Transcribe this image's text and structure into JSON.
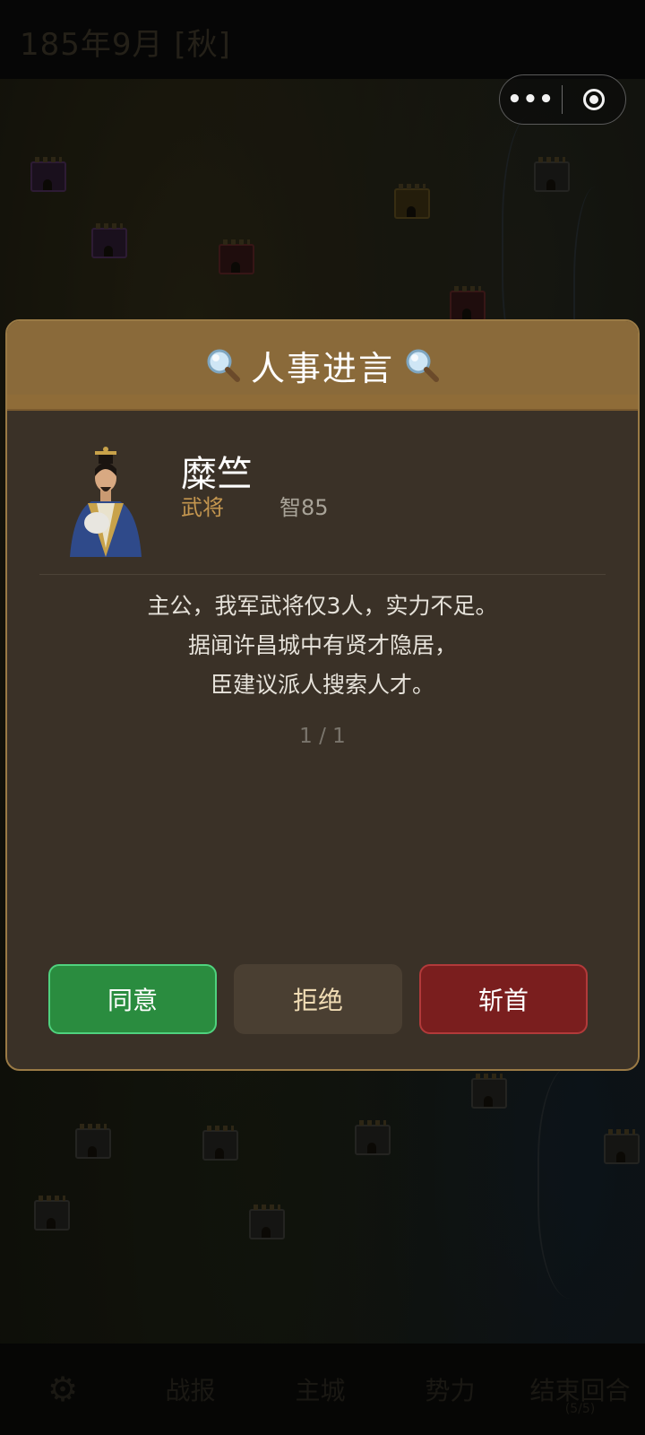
{
  "status_bar": {
    "date": "185年9月 [秋]"
  },
  "capsule": {
    "more_icon": "more-dots-icon",
    "more_glyph": "•••",
    "close_icon": "target-circle-icon"
  },
  "dialog": {
    "title": "人事进言",
    "title_icon": "magnifier-icon",
    "advisor": {
      "name": "糜竺",
      "role": "武将",
      "stat": "智85",
      "portrait_icon": "advisor-portrait"
    },
    "message_lines": [
      "主公，我军武将仅3人，实力不足。",
      "据闻许昌城中有贤才隐居，",
      "臣建议派人搜索人才。"
    ],
    "pager": "1 / 1",
    "buttons": {
      "agree": "同意",
      "reject": "拒绝",
      "behead": "斩首"
    }
  },
  "bottom_nav": {
    "settings_icon": "gear-icon",
    "settings_glyph": "⚙",
    "items": [
      "战报",
      "主城",
      "势力",
      "结束回合"
    ],
    "end_turn_sub": "(5/5)"
  },
  "colors": {
    "accent_gold": "#c4964f",
    "header_brown": "#8a6a3a",
    "agree_green": "#2a8c3f",
    "behead_red": "#7a1e1e"
  }
}
